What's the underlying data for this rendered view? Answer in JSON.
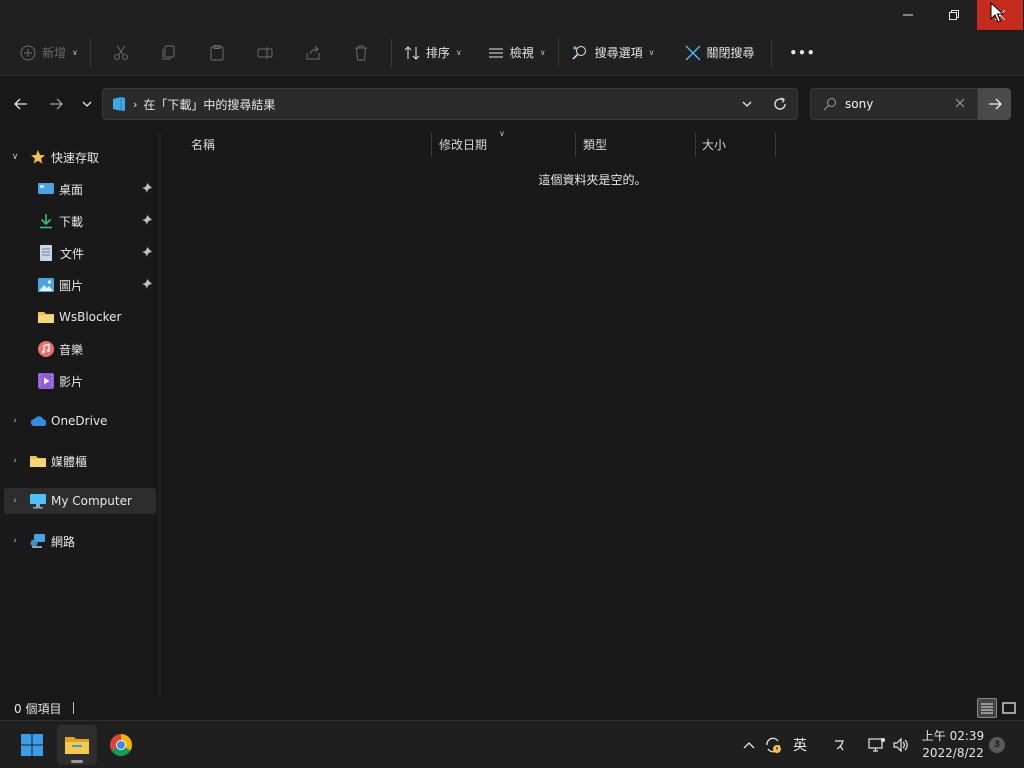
{
  "toolbar": {
    "new_label": "新增",
    "sort_label": "排序",
    "view_label": "檢視",
    "search_options_label": "搜尋選項",
    "close_search_label": "關閉搜尋",
    "more_label": "•••"
  },
  "address": {
    "path": "在「下載」中的搜尋結果"
  },
  "search": {
    "value": "sony"
  },
  "sidebar": {
    "quick_access": "快速存取",
    "items": [
      {
        "label": "桌面"
      },
      {
        "label": "下載"
      },
      {
        "label": "文件"
      },
      {
        "label": "圖片"
      },
      {
        "label": "WsBlocker"
      },
      {
        "label": "音樂"
      },
      {
        "label": "影片"
      }
    ],
    "onedrive": "OneDrive",
    "library": "媒體櫃",
    "my_computer": "My Computer",
    "network": "網路"
  },
  "columns": {
    "name": "名稱",
    "modified": "修改日期",
    "type": "類型",
    "size": "大小"
  },
  "content": {
    "empty_message": "這個資料夾是空的。"
  },
  "status": {
    "count": "0 個項目"
  },
  "taskbar": {
    "ime_label": "英",
    "clock_time": "上午 02:39",
    "clock_date": "2022/8/22",
    "notification_count": "3"
  },
  "colors": {
    "close_button": "#c42b1c",
    "folder_yellow": "#f2c14e",
    "accent_blue": "#4cc2ff"
  }
}
